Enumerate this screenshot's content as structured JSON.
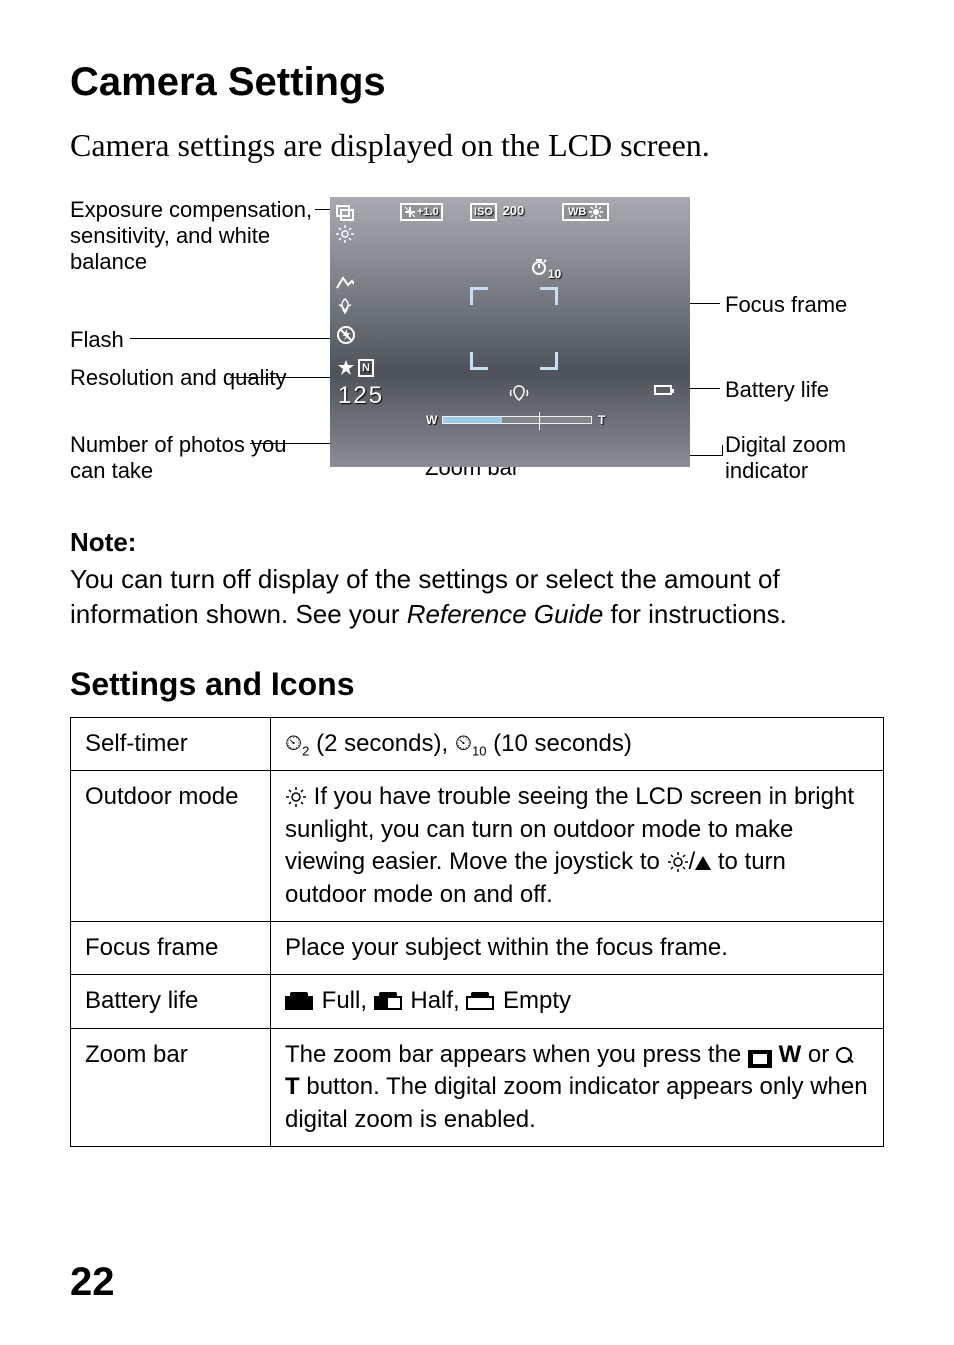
{
  "title": "Camera Settings",
  "subtitle": "Camera settings are displayed on the LCD screen.",
  "diagram": {
    "labels": {
      "exposure": "Exposure compensation, sensitivity, and white balance",
      "flash": "Flash",
      "resolution": "Resolution and quality",
      "photos_remaining": "Number of photos you can take",
      "zoom_bar": "Zoom bar",
      "focus_frame": "Focus frame",
      "battery_life": "Battery life",
      "digital_zoom": "Digital zoom indicator"
    },
    "lcd_osd": {
      "ev": "+1.0",
      "iso_label": "ISO",
      "iso_value": "200",
      "wb_label": "WB",
      "self_timer": "10",
      "resolution": "N",
      "shots_left": "125",
      "zoom_w": "W",
      "zoom_t": "T"
    }
  },
  "note": {
    "heading": "Note:",
    "body_pre": "You can turn off display of the settings or select the amount of information shown. See your ",
    "body_italic": "Reference Guide",
    "body_post": " for instructions."
  },
  "section_heading": "Settings and Icons",
  "table": {
    "rows": [
      {
        "name": "Self-timer",
        "desc": {
          "timer2_suffix": "2",
          "part1": " (2 seconds), ",
          "timer10_suffix": "10",
          "part2": " (10 seconds)"
        }
      },
      {
        "name": "Outdoor mode",
        "desc": {
          "part1": " If you have trouble seeing the LCD screen in bright sunlight, you can turn on outdoor mode to make viewing easier. Move the joystick to ",
          "part2": "/",
          "part3": " to turn outdoor mode on and off."
        }
      },
      {
        "name": "Focus frame",
        "desc": {
          "text": "Place your subject within the focus frame."
        }
      },
      {
        "name": "Battery life",
        "desc": {
          "full": " Full, ",
          "half": " Half, ",
          "empty": " Empty"
        }
      },
      {
        "name": "Zoom bar",
        "desc": {
          "part1": "The zoom bar appears when you press the ",
          "w": " W",
          "part2": " or ",
          "t": " T",
          "part3": " button. The digital zoom indicator appears only when digital zoom is enabled."
        }
      }
    ]
  },
  "page_number": "22"
}
